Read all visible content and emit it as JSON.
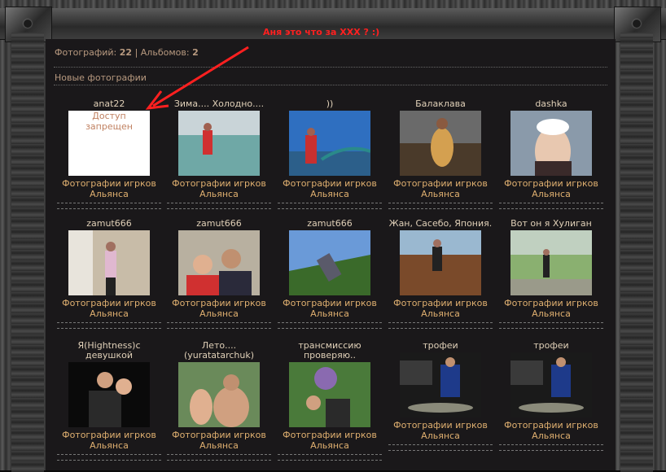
{
  "stats": {
    "photos_label": "Фотографий:",
    "photos_count": "22",
    "sep": "|",
    "albums_label": "Альбомов:",
    "albums_count": "2"
  },
  "section_title": "Новые фотографии",
  "annotation": "Аня это что за XXX ? :)",
  "colors": {
    "annotation": "#ff2020",
    "caption": "#e0b070",
    "title": "#e0d0b8"
  },
  "rows": [
    [
      {
        "title": "anat22",
        "caption": "Фотографии игрков Альянса",
        "thumb": "denied",
        "denied_text": "Доступ запрещен"
      },
      {
        "title": "Зима.... Холодно....",
        "caption": "Фотографии игрков Альянса",
        "thumb": "beach"
      },
      {
        "title": "))",
        "caption": "Фотографии игрков Альянса",
        "thumb": "pier"
      },
      {
        "title": "Балаклава",
        "caption": "Фотографии игрков Альянса",
        "thumb": "sitting"
      },
      {
        "title": "dashka",
        "caption": "Фотографии игрков Альянса",
        "thumb": "portrait"
      }
    ],
    [
      {
        "title": "zamut666",
        "caption": "Фотографии игрков Альянса",
        "thumb": "room"
      },
      {
        "title": "zamut666",
        "caption": "Фотографии игрков Альянса",
        "thumb": "couple"
      },
      {
        "title": "zamut666",
        "caption": "Фотографии игрков Альянса",
        "thumb": "sky"
      },
      {
        "title": "Жан, Сасебо, Япония.",
        "caption": "Фотографии игрков Альянса",
        "thumb": "ship"
      },
      {
        "title": "Вот он я Хулиган",
        "caption": "Фотографии игрков Альянса",
        "thumb": "park"
      }
    ],
    [
      {
        "title": "Я(Hightness)с девушкой",
        "caption": "Фотографии игрков Альянса",
        "thumb": "night"
      },
      {
        "title": "Лето.... (yuratatarchuk)",
        "caption": "Фотографии игрков Альянса",
        "thumb": "summer"
      },
      {
        "title": "трансмиссию проверяю..",
        "caption": "Фотографии игрков Альянса",
        "thumb": "garden"
      },
      {
        "title": "трофеи",
        "caption": "Фотографии игрков Альянса",
        "thumb": "fish"
      },
      {
        "title": "трофеи",
        "caption": "Фотографии игрков Альянса",
        "thumb": "fish"
      }
    ]
  ]
}
